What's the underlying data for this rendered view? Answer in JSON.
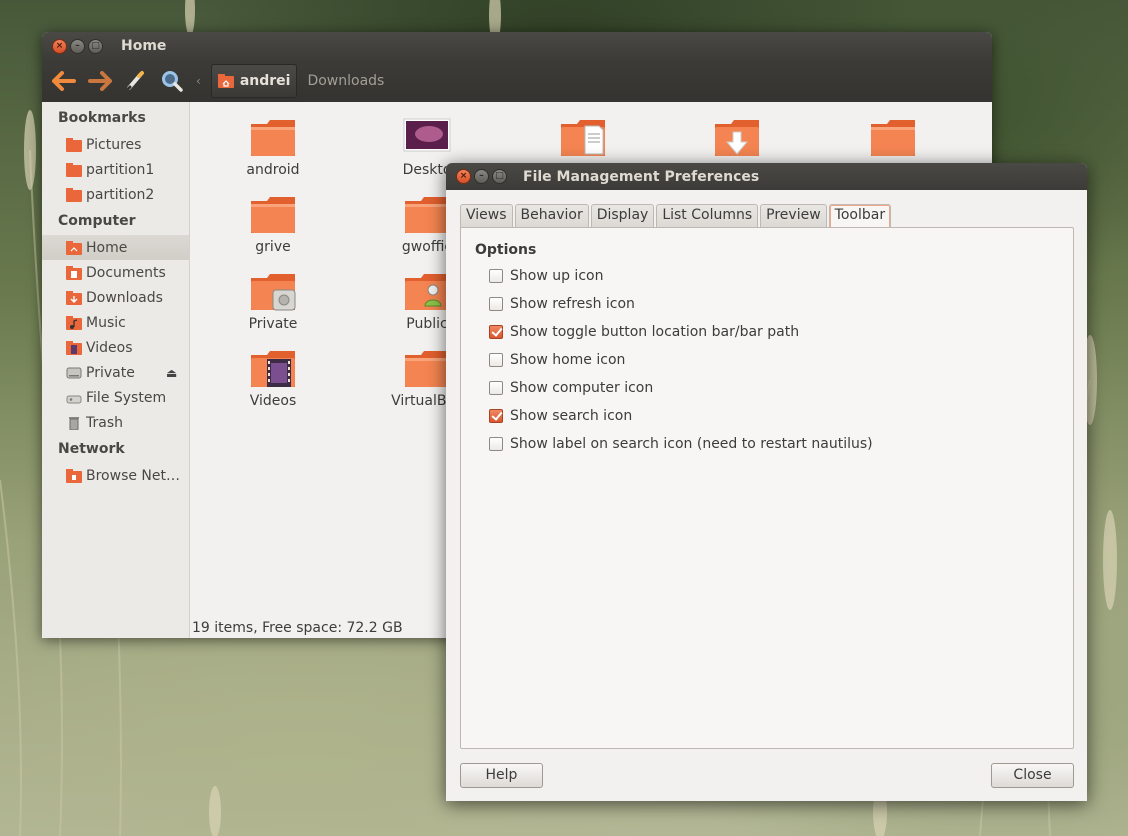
{
  "file_manager": {
    "window_title": "Home",
    "toolbar": {
      "back_icon": "back-arrow-icon",
      "forward_icon": "forward-arrow-icon",
      "edit_icon": "pencil-icon",
      "search_icon": "search-icon",
      "breadcrumbs": [
        "andrei",
        "Downloads"
      ]
    },
    "sidebar": {
      "sections": [
        {
          "heading": "Bookmarks",
          "items": [
            {
              "label": "Pictures",
              "icon": "folder-icon"
            },
            {
              "label": "partition1",
              "icon": "folder-icon"
            },
            {
              "label": "partition2",
              "icon": "folder-icon"
            }
          ]
        },
        {
          "heading": "Computer",
          "items": [
            {
              "label": "Home",
              "icon": "home-folder-icon",
              "active": true
            },
            {
              "label": "Documents",
              "icon": "documents-icon"
            },
            {
              "label": "Downloads",
              "icon": "downloads-icon"
            },
            {
              "label": "Music",
              "icon": "music-icon"
            },
            {
              "label": "Videos",
              "icon": "videos-icon"
            },
            {
              "label": "Private",
              "icon": "drive-icon",
              "eject": true
            },
            {
              "label": "File System",
              "icon": "filesystem-icon"
            },
            {
              "label": "Trash",
              "icon": "trash-icon"
            }
          ]
        },
        {
          "heading": "Network",
          "items": [
            {
              "label": "Browse Net…",
              "icon": "network-icon"
            }
          ]
        }
      ]
    },
    "files": [
      {
        "name": "android",
        "icon": "folder-icon"
      },
      {
        "name": "Deskto",
        "icon": "desktop-folder-icon"
      },
      {
        "name": "",
        "icon": "documents-folder-icon"
      },
      {
        "name": "",
        "icon": "downloads-folder-icon"
      },
      {
        "name": "",
        "icon": "folder-icon"
      },
      {
        "name": "grive",
        "icon": "folder-icon"
      },
      {
        "name": "gwoffic",
        "icon": "folder-icon"
      },
      {
        "name": "Private",
        "icon": "private-folder-icon"
      },
      {
        "name": "Public",
        "icon": "public-folder-icon"
      },
      {
        "name": "Videos",
        "icon": "videos-folder-icon"
      },
      {
        "name": "VirtualBox",
        "icon": "folder-icon"
      }
    ],
    "status": "19 items, Free space: 72.2 GB"
  },
  "preferences": {
    "title": "File Management Preferences",
    "tabs": [
      "Views",
      "Behavior",
      "Display",
      "List Columns",
      "Preview",
      "Toolbar"
    ],
    "active_tab": "Toolbar",
    "options_heading": "Options",
    "options": [
      {
        "label": "Show up icon",
        "checked": false
      },
      {
        "label": "Show refresh icon",
        "checked": false
      },
      {
        "label": "Show toggle button location bar/bar path",
        "checked": true
      },
      {
        "label": "Show home icon",
        "checked": false
      },
      {
        "label": "Show computer icon",
        "checked": false
      },
      {
        "label": "Show search icon",
        "checked": true
      },
      {
        "label": "Show label on search icon (need to restart nautilus)",
        "checked": false
      }
    ],
    "help_label": "Help",
    "close_label": "Close"
  },
  "colors": {
    "accent": "#dd4814",
    "folder_orange": "#f07746",
    "titlebar_dark": "#3c3b37",
    "window_bg": "#f2f1f0"
  }
}
